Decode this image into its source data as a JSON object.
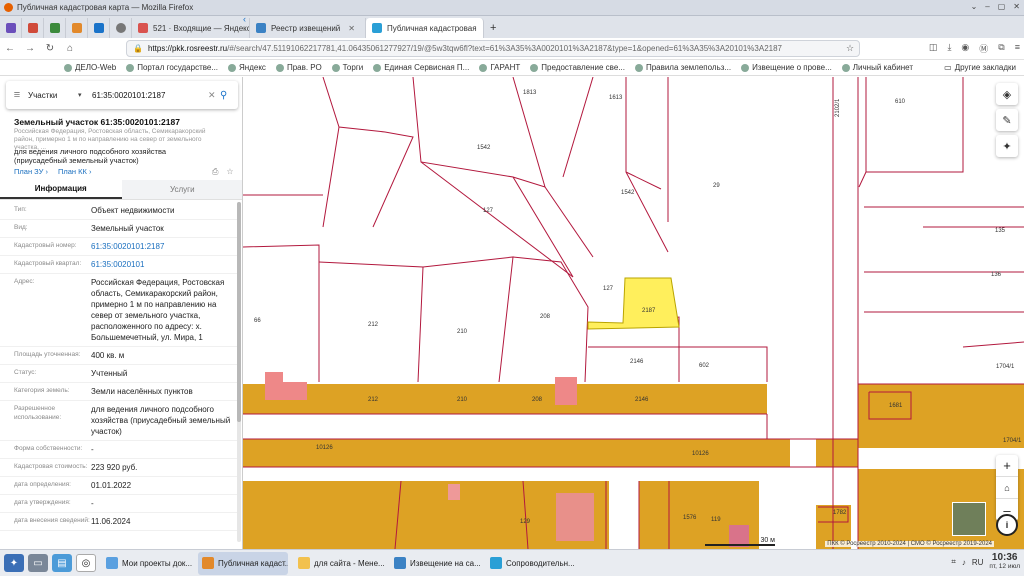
{
  "window": {
    "title": "Публичная кадастровая карта — Mozilla Firefox",
    "controls": [
      "⌄",
      "–",
      "▢",
      "✕"
    ]
  },
  "tabs": [
    {
      "label": "521 · Входящие — Яндекс",
      "color": "#d9534f"
    },
    {
      "label": "Реестр извещений",
      "color": "#3b82c4"
    },
    {
      "label": "Публичная кадастровая",
      "color": "#2a9fd6"
    }
  ],
  "new_tab": "+",
  "address": {
    "host": "https://pkk.rosreestr.ru",
    "path": "/#/search/47.51191062217781,41.06435061277927/19/@5w3tqw6fl?text=61%3A35%3A0020101%3A2187&type=1&opened=61%3A35%3A20101%3A2187"
  },
  "bookmarks": [
    "ДЕЛО-Web",
    "Портал государстве...",
    "Яндекс",
    "Прав. РО",
    "Торги",
    "Единая Сервисная П...",
    "ГАРАНТ",
    "Предоставление све...",
    "Правила землепольз...",
    "Извещение о прове...",
    "Личный кабинет"
  ],
  "bookmarks_other": "Другие закладки",
  "search": {
    "layer": "Участки",
    "query": "61:35:0020101:2187"
  },
  "parcel": {
    "title": "Земельный участок 61:35:0020101:2187",
    "address_short": "Российская Федерация, Ростовская область, Семикаракорский район, примерно 1 м по направлению на север от земельного участка, ...",
    "use": "для ведения личного подсобного хозяйства (приусадебный земельный участок)",
    "link_zu": "План ЗУ ›",
    "link_kk": "План КК ›"
  },
  "panel_tabs": {
    "info": "Информация",
    "services": "Услуги"
  },
  "rows": [
    {
      "k": "Тип:",
      "v": "Объект недвижимости"
    },
    {
      "k": "Вид:",
      "v": "Земельный участок"
    },
    {
      "k": "Кадастровый номер:",
      "v": "61:35:0020101:2187",
      "link": true
    },
    {
      "k": "Кадастровый квартал:",
      "v": "61:35:0020101",
      "link": true
    },
    {
      "k": "Адрес:",
      "v": "Российская Федерация, Ростовская область, Семикаракорский район, примерно 1 м по направлению на север от земельного участка, расположенного по адресу: х. Большемечетный, ул. Мира, 1"
    },
    {
      "k": "Площадь уточненная:",
      "v": "400 кв. м"
    },
    {
      "k": "Статус:",
      "v": "Учтенный"
    },
    {
      "k": "Категория земель:",
      "v": "Земли населённых пунктов"
    },
    {
      "k": "Разрешенное использование:",
      "v": "для ведения личного подсобного хозяйства (приусадебный земельный участок)"
    },
    {
      "k": "Форма собственности:",
      "v": "-"
    },
    {
      "k": "Кадастровая стоимость:",
      "v": "223 920 руб."
    },
    {
      "k": "дата определения:",
      "v": "01.01.2022"
    },
    {
      "k": "дата утверждения:",
      "v": "-"
    },
    {
      "k": "дата внесения сведений:",
      "v": "11.06.2024"
    }
  ],
  "map": {
    "labels": [
      "1813",
      "1613",
      "1542",
      "1542",
      "29",
      "127",
      "127",
      "2187",
      "212",
      "210",
      "208",
      "2146",
      "602",
      "66",
      "212",
      "210",
      "208",
      "2146",
      "10126",
      "10126",
      "129",
      "1576",
      "119",
      "1782",
      "610",
      "135",
      "136",
      "1704/1",
      "1704/1",
      "1681",
      "2102/1"
    ],
    "scale": "30 м",
    "copyright": "ПКК © Росреестр 2010-2024 | СМО © Росреестр 2019-2024",
    "zoom_in": "+",
    "zoom_out": "–",
    "info": "i"
  },
  "taskbar": [
    {
      "label": "Мои проекты док...",
      "color": "#5aa0e0"
    },
    {
      "label": "Публичная кадаст...",
      "color": "#e2892b",
      "active": true
    },
    {
      "label": "для сайта - Мене...",
      "color": "#f2c14e"
    },
    {
      "label": "Извещение на са...",
      "color": "#3b82c4"
    },
    {
      "label": "Сопроводительн...",
      "color": "#2a9fd6"
    }
  ],
  "tray": {
    "lang": "RU",
    "time": "10:36",
    "date": "пт, 12 июл"
  }
}
